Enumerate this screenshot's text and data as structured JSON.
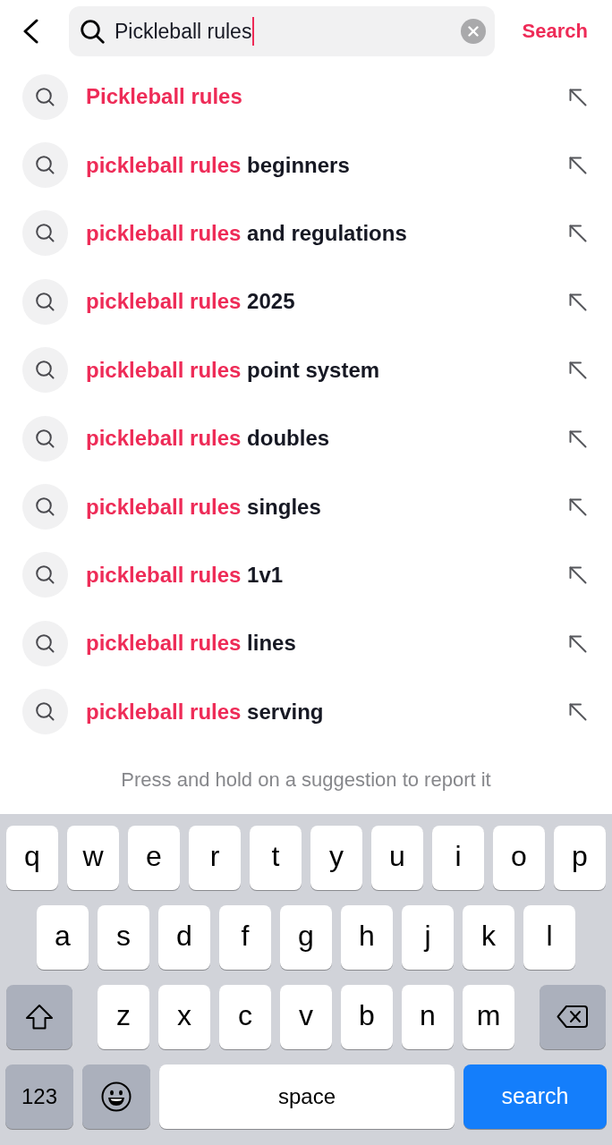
{
  "top_bar": {
    "search_field": {
      "value": "Pickleball rules",
      "focused": true
    },
    "search_button": "Search"
  },
  "suggestions": [
    {
      "highlighted": "Pickleball rules"
    },
    {
      "highlighted": "pickleball rules",
      "completion": "beginners"
    },
    {
      "highlighted": "pickleball rules",
      "completion": "and regulations"
    },
    {
      "highlighted": "pickleball rules",
      "completion": "2025"
    },
    {
      "highlighted": "pickleball rules",
      "completion": "point system"
    },
    {
      "highlighted": "pickleball rules",
      "completion": "doubles"
    },
    {
      "highlighted": "pickleball rules",
      "completion": "singles"
    },
    {
      "highlighted": "pickleball rules",
      "completion": "1v1"
    },
    {
      "highlighted": "pickleball rules",
      "completion": "lines"
    },
    {
      "highlighted": "pickleball rules",
      "completion": "serving"
    }
  ],
  "hint": "Press and hold on a suggestion to report it",
  "keyboard": {
    "key_rows": [
      {
        "keys": [
          {
            "kind": "letter",
            "label": "q"
          },
          {
            "kind": "letter",
            "label": "w"
          },
          {
            "kind": "letter",
            "label": "e"
          },
          {
            "kind": "letter",
            "label": "r"
          },
          {
            "kind": "letter",
            "label": "t"
          },
          {
            "kind": "letter",
            "label": "y"
          },
          {
            "kind": "letter",
            "label": "u"
          },
          {
            "kind": "letter",
            "label": "i"
          },
          {
            "kind": "letter",
            "label": "o"
          },
          {
            "kind": "letter",
            "label": "p"
          }
        ]
      },
      {
        "keys": [
          {
            "kind": "letter",
            "label": "a"
          },
          {
            "kind": "letter",
            "label": "s"
          },
          {
            "kind": "letter",
            "label": "d"
          },
          {
            "kind": "letter",
            "label": "f"
          },
          {
            "kind": "letter",
            "label": "g"
          },
          {
            "kind": "letter",
            "label": "h"
          },
          {
            "kind": "letter",
            "label": "j"
          },
          {
            "kind": "letter",
            "label": "k"
          },
          {
            "kind": "letter",
            "label": "l"
          }
        ]
      },
      {
        "keys": [
          {
            "kind": "shift"
          },
          {
            "kind": "letter",
            "label": "z"
          },
          {
            "kind": "letter",
            "label": "x"
          },
          {
            "kind": "letter",
            "label": "c"
          },
          {
            "kind": "letter",
            "label": "v"
          },
          {
            "kind": "letter",
            "label": "b"
          },
          {
            "kind": "letter",
            "label": "n"
          },
          {
            "kind": "letter",
            "label": "m"
          },
          {
            "kind": "delete"
          }
        ]
      },
      {
        "keys": [
          {
            "kind": "mode",
            "label": "123"
          },
          {
            "kind": "emoji"
          },
          {
            "kind": "space",
            "label": "space"
          },
          {
            "kind": "action",
            "label": "search"
          }
        ]
      }
    ]
  }
}
